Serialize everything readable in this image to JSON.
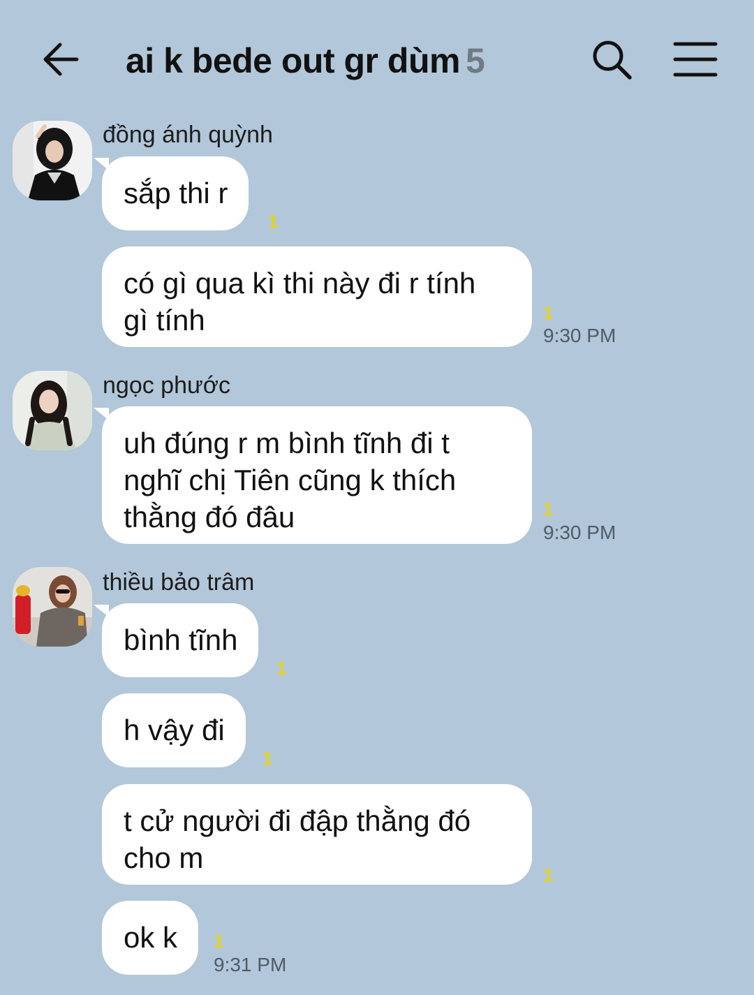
{
  "header": {
    "title": "ai k bede out gr dùm",
    "member_count": "5",
    "icons": {
      "back": "arrow-left-icon",
      "search": "search-icon",
      "menu": "hamburger-menu-icon"
    }
  },
  "messages": [
    {
      "sender": "đồng ánh quỳnh",
      "text": "sắp thi r",
      "unread": "1"
    },
    {
      "text": "có gì qua kì thi này đi r tính\ngì tính",
      "unread": "1",
      "time": "9:30 PM"
    },
    {
      "sender": "ngọc phước",
      "text": "uh đúng r m bình tĩnh đi t\nnghĩ chị Tiên cũng k thích\nthằng đó đâu",
      "unread": "1",
      "time": "9:30 PM"
    },
    {
      "sender": "thiều bảo trâm",
      "text": "bình tĩnh",
      "unread": "1"
    },
    {
      "text": "h vậy đi",
      "unread": "1"
    },
    {
      "text": "t cử người đi đập thằng đó\ncho m",
      "unread": "1"
    },
    {
      "text": "ok k",
      "unread": "1",
      "time": "9:31 PM"
    }
  ],
  "colors": {
    "background": "#b2c7d9",
    "bubble": "#ffffff",
    "unread": "#e6d21a",
    "time": "#4f5b66",
    "count": "#6f7a85"
  }
}
